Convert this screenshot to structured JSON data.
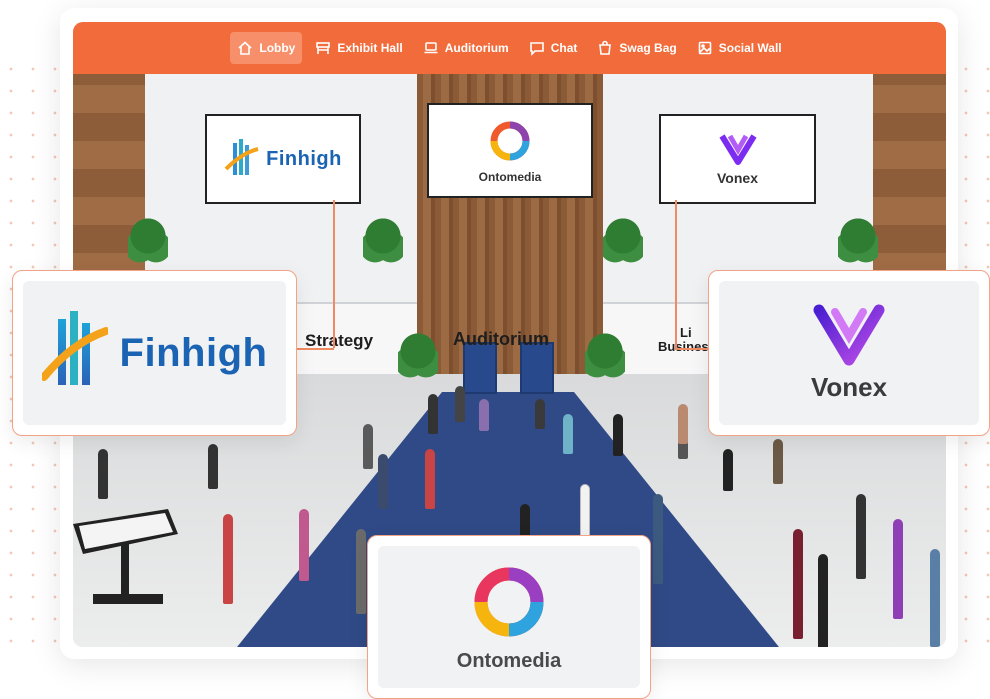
{
  "nav": {
    "items": [
      {
        "label": "Lobby",
        "icon": "home-icon",
        "active": true
      },
      {
        "label": "Exhibit Hall",
        "icon": "booth-icon",
        "active": false
      },
      {
        "label": "Auditorium",
        "icon": "laptop-icon",
        "active": false
      },
      {
        "label": "Chat",
        "icon": "chat-bubble-icon",
        "active": false
      },
      {
        "label": "Swag Bag",
        "icon": "bag-icon",
        "active": false
      },
      {
        "label": "Social Wall",
        "icon": "image-icon",
        "active": false
      }
    ],
    "color": "#f26b3a"
  },
  "scene": {
    "screens": {
      "finhigh": "Finhigh",
      "ontomedia": "Ontomedia",
      "vonex": "Vonex"
    },
    "halls": {
      "strategy": "Strategy",
      "auditorium": "Auditorium",
      "business_line1": "Li",
      "business_line2": "Busines"
    }
  },
  "sponsors": {
    "finhigh": "Finhigh",
    "vonex": "Vonex",
    "ontomedia": "Ontomedia"
  },
  "colors": {
    "accent": "#f26b3a",
    "finhigh_blue": "#1b63b3",
    "vonex_purple": "#7b2cf0"
  }
}
